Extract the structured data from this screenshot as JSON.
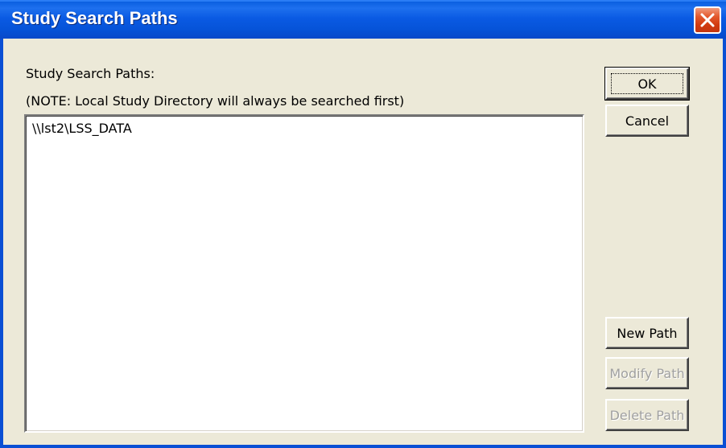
{
  "window": {
    "title": "Study Search Paths"
  },
  "labels": {
    "heading": "Study Search Paths:",
    "note": "(NOTE: Local Study Directory will always be searched first)"
  },
  "paths": [
    "\\\\lst2\\LSS_DATA"
  ],
  "buttons": {
    "ok": "OK",
    "cancel": "Cancel",
    "new_path": "New Path",
    "modify_path": "Modify Path",
    "delete_path": "Delete Path"
  },
  "button_states": {
    "modify_path_enabled": false,
    "delete_path_enabled": false
  },
  "colors": {
    "titlebar": "#0a5ae3",
    "close_button": "#d13a10",
    "dialog_face": "#ece9d8"
  },
  "icons": {
    "close": "close-icon"
  }
}
